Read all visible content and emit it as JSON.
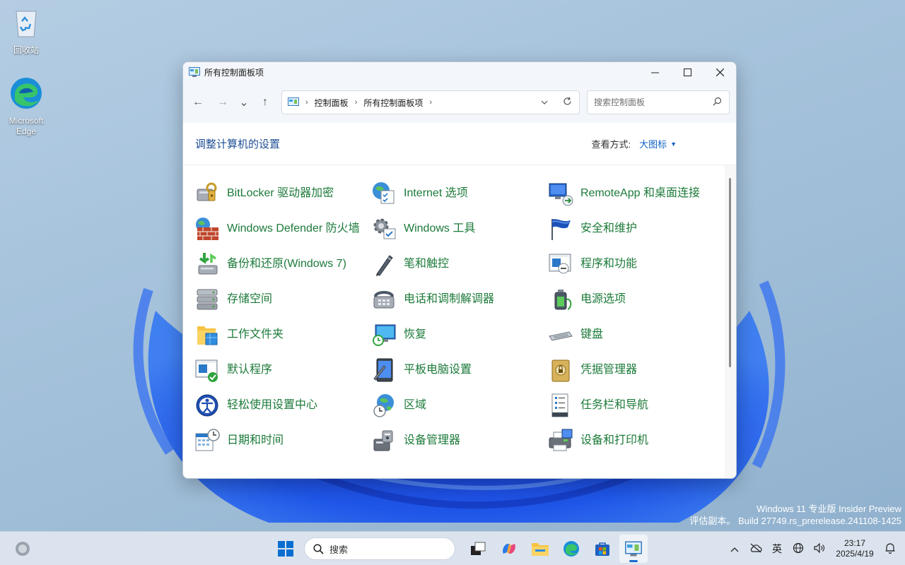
{
  "desktop": {
    "recycle_bin": "回收站",
    "edge_line1": "Microsoft",
    "edge_line2": "Edge"
  },
  "window": {
    "title": "所有控制面板项",
    "nav": {
      "back": "←",
      "forward": "→",
      "recent": "⌄",
      "up": "↑"
    },
    "address": {
      "crumbs": [
        "控制面板",
        "所有控制面板项"
      ],
      "separator": "›"
    },
    "search_placeholder": "搜索控制面板",
    "heading": "调整计算机的设置",
    "view_by_label": "查看方式:",
    "view_by_value": "大图标",
    "items": [
      {
        "label": "BitLocker 驱动器加密",
        "icon": "bitlocker-icon"
      },
      {
        "label": "Internet 选项",
        "icon": "internet-options-icon"
      },
      {
        "label": "RemoteApp 和桌面连接",
        "icon": "remoteapp-icon"
      },
      {
        "label": "Windows Defender 防火墙",
        "icon": "firewall-icon"
      },
      {
        "label": "Windows 工具",
        "icon": "windows-tools-icon"
      },
      {
        "label": "安全和维护",
        "icon": "security-flag-icon"
      },
      {
        "label": "备份和还原(Windows 7)",
        "icon": "backup-icon"
      },
      {
        "label": "笔和触控",
        "icon": "pen-icon"
      },
      {
        "label": "程序和功能",
        "icon": "programs-icon"
      },
      {
        "label": "存储空间",
        "icon": "storage-icon"
      },
      {
        "label": "电话和调制解调器",
        "icon": "phone-modem-icon"
      },
      {
        "label": "电源选项",
        "icon": "power-icon"
      },
      {
        "label": "工作文件夹",
        "icon": "work-folders-icon"
      },
      {
        "label": "恢复",
        "icon": "recovery-icon"
      },
      {
        "label": "键盘",
        "icon": "keyboard-icon"
      },
      {
        "label": "默认程序",
        "icon": "default-programs-icon"
      },
      {
        "label": "平板电脑设置",
        "icon": "tablet-icon"
      },
      {
        "label": "凭据管理器",
        "icon": "credential-icon"
      },
      {
        "label": "轻松使用设置中心",
        "icon": "ease-of-access-icon"
      },
      {
        "label": "区域",
        "icon": "region-icon"
      },
      {
        "label": "任务栏和导航",
        "icon": "taskbar-nav-icon"
      },
      {
        "label": "日期和时间",
        "icon": "datetime-icon"
      },
      {
        "label": "设备管理器",
        "icon": "device-manager-icon"
      },
      {
        "label": "设备和打印机",
        "icon": "printer-icon"
      }
    ]
  },
  "watermark": {
    "line1": "Windows 11 专业版 Insider Preview",
    "line2": "评估副本。 Build 27749.rs_prerelease.241108-1425"
  },
  "taskbar": {
    "search_label": "搜索",
    "ime": "英",
    "time": "23:17",
    "date": "2025/4/19"
  },
  "colors": {
    "link_green": "#1c7a3a",
    "heading_blue": "#1e4e95",
    "accent": "#1062c4"
  }
}
